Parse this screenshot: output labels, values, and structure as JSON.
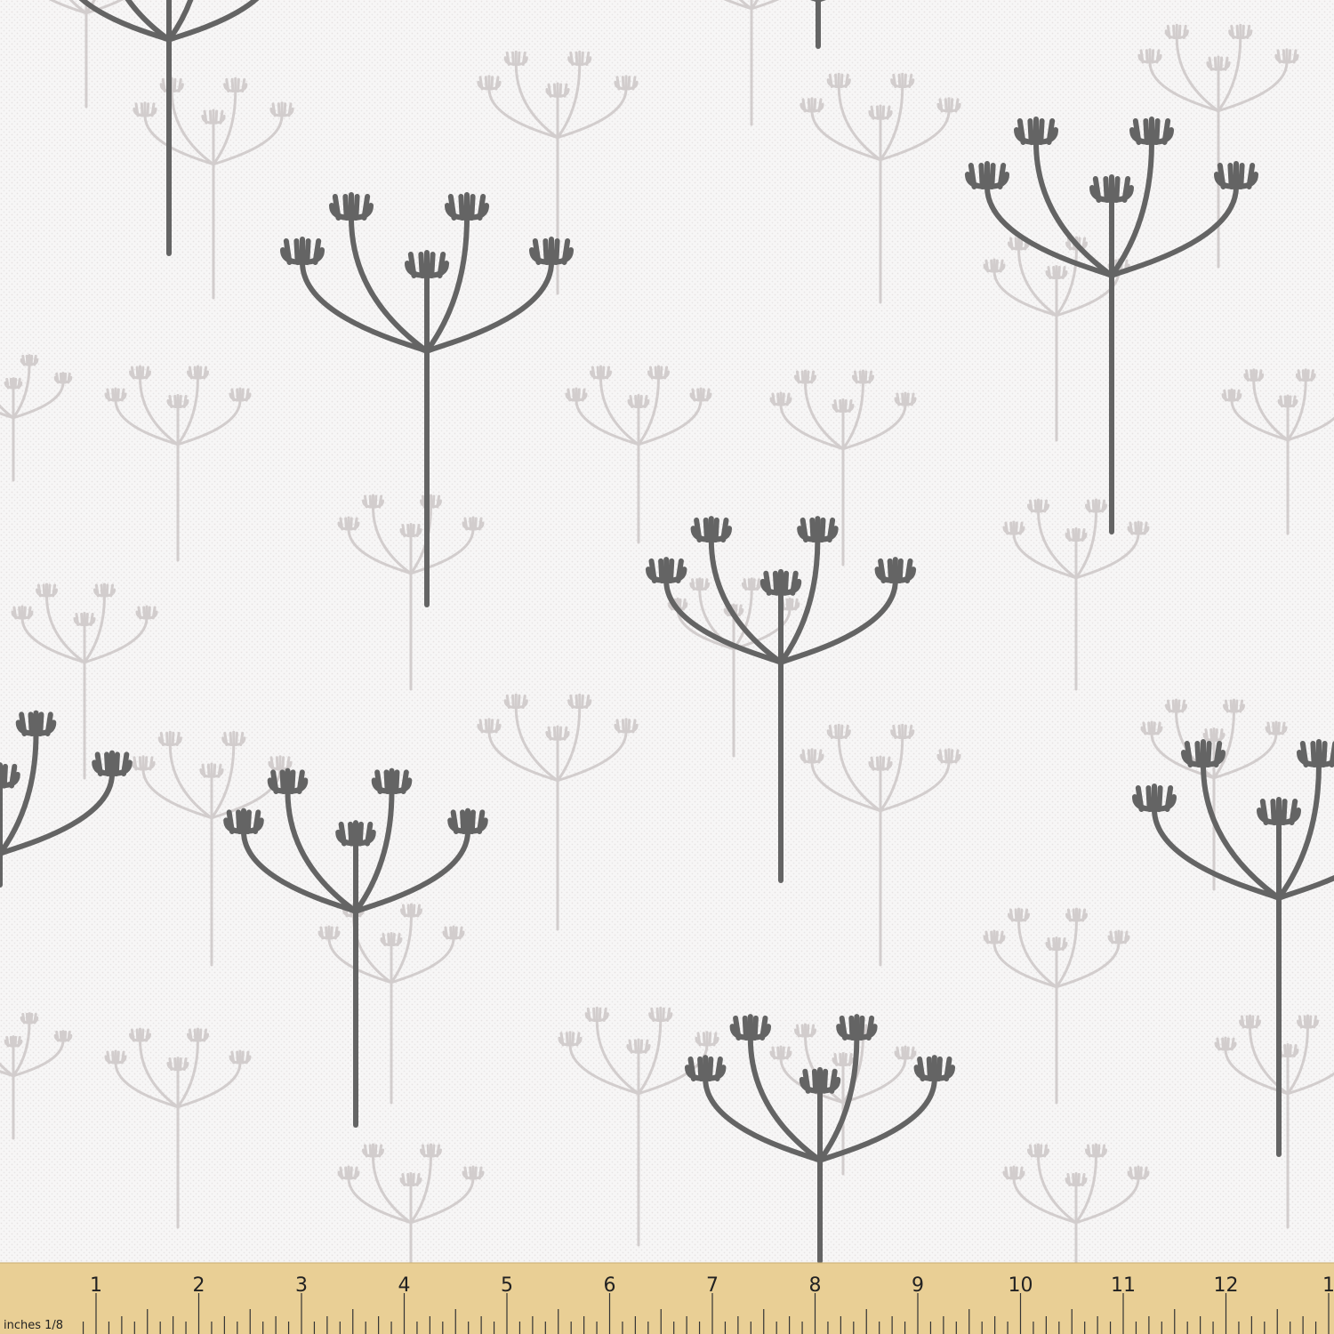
{
  "fabric": {
    "background_color": "#f7f6f6",
    "texture_color": "#e6e3e3",
    "dark_plant_color": "#646464",
    "light_plant_color": "#d2cdcd",
    "motif": "umbel-flower-icon"
  },
  "ruler": {
    "color": "#e9cf95",
    "units_label": "inches 1/8",
    "numbers": [
      "1",
      "2",
      "3",
      "4",
      "5",
      "6",
      "7",
      "8",
      "9",
      "10",
      "11",
      "12",
      "1"
    ]
  }
}
